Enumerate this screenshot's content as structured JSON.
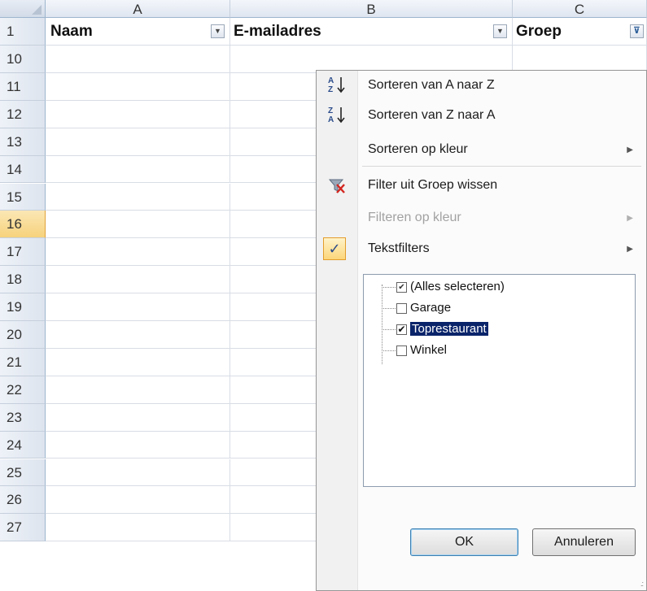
{
  "columns": [
    "A",
    "B",
    "C"
  ],
  "header_row": {
    "row_number": "1",
    "cells": [
      "Naam",
      "E-mailadres",
      "Groep"
    ]
  },
  "rows": [
    "10",
    "11",
    "12",
    "13",
    "14",
    "15",
    "16",
    "17",
    "18",
    "19",
    "20",
    "21",
    "22",
    "23",
    "24",
    "25",
    "26",
    "27"
  ],
  "selected_row": "16",
  "icons": {
    "dropdown_a": "dropdown-arrow-icon",
    "dropdown_b": "dropdown-arrow-icon",
    "dropdown_c": "filter-active-icon",
    "sort_az": "sort-ascending-icon",
    "sort_za": "sort-descending-icon",
    "clear_filter": "clear-filter-icon",
    "text_filter_check": "checkmark-icon"
  },
  "menu": {
    "sort_az": "Sorteren van A naar Z",
    "sort_za": "Sorteren van Z naar A",
    "sort_by_color": "Sorteren op kleur",
    "clear_filter": "Filter uit Groep wissen",
    "filter_by_color": "Filteren op kleur",
    "text_filters": "Tekstfilters"
  },
  "filter_list": [
    {
      "label": "(Alles selecteren)",
      "checked": "partial"
    },
    {
      "label": "Garage",
      "checked": false
    },
    {
      "label": "Toprestaurant",
      "checked": true
    },
    {
      "label": "Winkel",
      "checked": false
    }
  ],
  "buttons": {
    "ok": "OK",
    "cancel": "Annuleren"
  },
  "colors": {
    "selection_highlight": "#0a246a",
    "selected_row_header": "#f6d27c",
    "header_gradient_light": "#f3f6fb",
    "header_gradient_dark": "#dfe6f0"
  }
}
